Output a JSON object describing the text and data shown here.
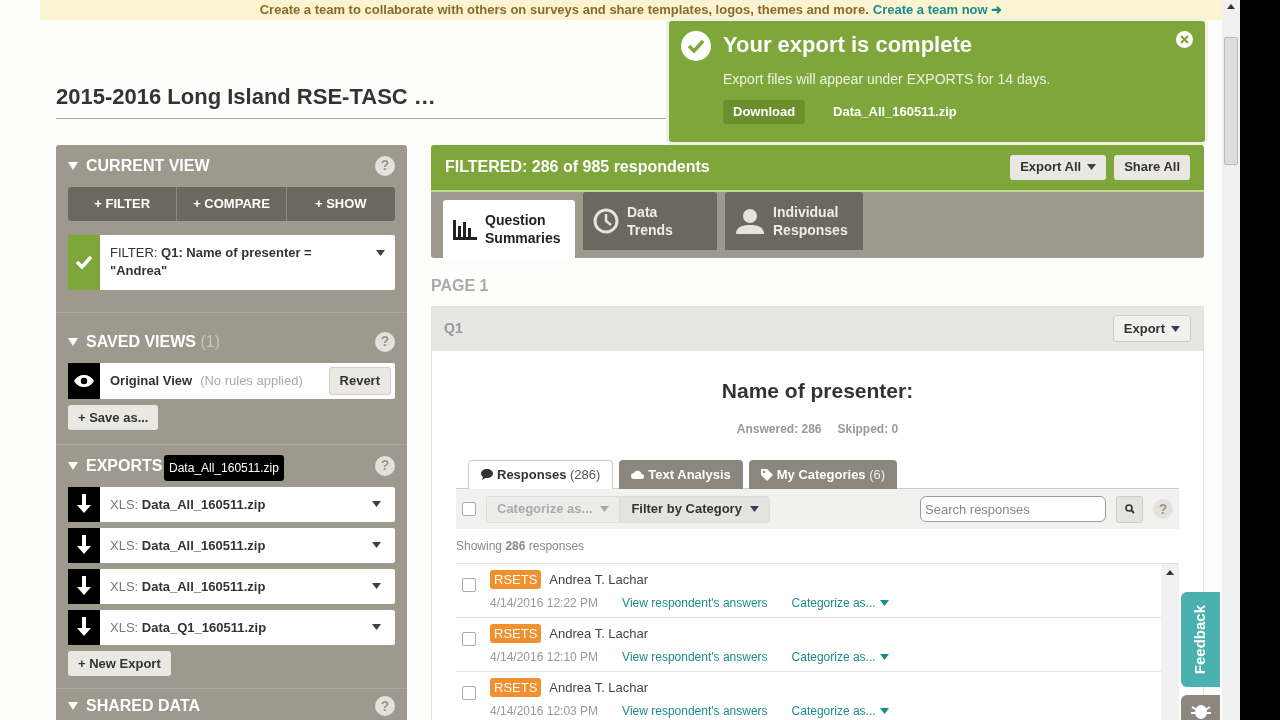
{
  "banner": {
    "text": "Create a team to collaborate with others on surveys and share templates, logos, themes and more.",
    "link": "Create a team now ➜"
  },
  "title": "2015-2016 Long Island RSE-TASC …",
  "toast": {
    "title": "Your export is complete",
    "message": "Export files will appear under EXPORTS for 14 days.",
    "button": "Download",
    "file": "Data_All_160511.zip"
  },
  "sidebar": {
    "current_view": {
      "heading": "CURRENT VIEW",
      "help": "?",
      "expanded": true,
      "actions": [
        "+ FILTER",
        "+ COMPARE",
        "+ SHOW"
      ],
      "filter": {
        "checked": true,
        "label": "FILTER:",
        "rule": "Q1: Name of presenter = \"Andrea\""
      }
    },
    "saved_views": {
      "heading": "SAVED VIEWS",
      "help": "?",
      "count": "(1)",
      "expanded": true,
      "item": {
        "name": "Original View",
        "note": "(No rules applied)",
        "button": "Revert"
      },
      "add": "+ Save as..."
    },
    "exports": {
      "heading": "EXPORTS",
      "help": "?",
      "expanded": true,
      "tooltip": "Data_All_160511.zip",
      "items": [
        {
          "format": "XLS:",
          "file": "Data_All_160511.zip"
        },
        {
          "format": "XLS:",
          "file": "Data_All_160511.zip"
        },
        {
          "format": "XLS:",
          "file": "Data_All_160511.zip"
        },
        {
          "format": "XLS:",
          "file": "Data_Q1_160511.zip"
        }
      ],
      "add": "+ New Export"
    },
    "shared_data": {
      "heading": "SHARED DATA",
      "help": "?",
      "expanded": true
    }
  },
  "results": {
    "filtered": "FILTERED: 286 of 985 respondents",
    "buttons": [
      "Export All",
      "Share All"
    ],
    "tabs": [
      {
        "kind": "chart",
        "label": "Question Summaries",
        "selected": true
      },
      {
        "kind": "clock",
        "label": "Data Trends",
        "selected": false
      },
      {
        "kind": "person",
        "label": "Individual Responses",
        "selected": false
      }
    ],
    "page": "PAGE 1",
    "question": {
      "number": "Q1",
      "export": "Export",
      "title": "Name of presenter:",
      "answered": "Answered: 286",
      "skipped": "Skipped: 0",
      "subtabs": [
        {
          "kind": "bubble",
          "label": "Responses",
          "count": "(286)",
          "selected": true
        },
        {
          "kind": "cloud",
          "label": "Text Analysis",
          "selected": false
        },
        {
          "kind": "tag",
          "label": "My Categories",
          "count": "(6)",
          "selected": false
        }
      ],
      "toolbar": {
        "select_all": false,
        "categorize": {
          "label": "Categorize as...",
          "disabled": true
        },
        "filter": "Filter by Category",
        "search_placeholder": "Search responses",
        "help": "?"
      },
      "showing": "Showing **286** responses",
      "responses": [
        {
          "checked": false,
          "tag": "RSETS",
          "color": "#f0902e",
          "name": "Andrea T. Lachar",
          "date": "4/14/2016 12:22 PM",
          "link": "View respondent's answers",
          "categorize": "Categorize as..."
        },
        {
          "checked": false,
          "tag": "RSETS",
          "color": "#f0902e",
          "name": "Andrea T. Lachar",
          "date": "4/14/2016 12:10 PM",
          "link": "View respondent's answers",
          "categorize": "Categorize as..."
        },
        {
          "checked": false,
          "tag": "RSETS",
          "color": "#f0902e",
          "name": "Andrea T. Lachar",
          "date": "4/14/2016 12:03 PM",
          "link": "View respondent's answers",
          "categorize": "Categorize as..."
        }
      ]
    }
  },
  "feedback": "Feedback"
}
